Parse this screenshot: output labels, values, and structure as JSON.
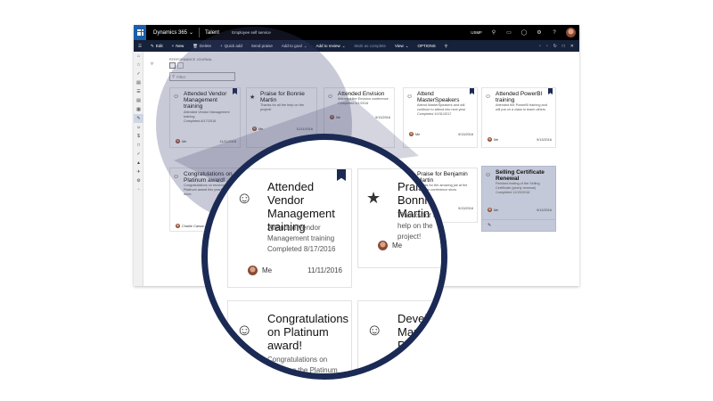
{
  "navbar": {
    "app_name": "Dynamics 365",
    "module": "Talent",
    "area": "Employee self service",
    "company": "USMF",
    "icons": [
      "search-icon",
      "chat-icon",
      "favorite-icon",
      "settings-icon",
      "help-icon"
    ]
  },
  "actionpane": {
    "edit": "Edit",
    "new": "New",
    "delete": "Delete",
    "quick_add": "Quick add",
    "send_praise": "Send praise",
    "add_to_goal": "Add to goal",
    "add_to_review": "Add to review",
    "mark_complete": "Mark as complete",
    "view": "View",
    "options": "OPTIONS"
  },
  "workspace": {
    "breadcrumb": "PERFORMANCE JOURNAL",
    "filter_placeholder": "Filter"
  },
  "cards": [
    {
      "icon": "person-icon",
      "title": "Attended Vendor Management training",
      "desc": "Attended Vendor Management training",
      "status": "Completed 8/17/2016",
      "person": "Me",
      "date": "11/11/2016",
      "bookmarked": true
    },
    {
      "icon": "star-icon",
      "title": "Praise for Bonnie Martin",
      "desc": "Thanks for all the help on the project!",
      "status": "",
      "person": "Me",
      "date": "11/11/2016",
      "bookmarked": false
    },
    {
      "icon": "person-icon",
      "title": "Attended Envision",
      "desc": "Attended the Envision conference",
      "status": "Completed 9/1/2016",
      "person": "Me",
      "date": "9/13/2016",
      "bookmarked": false
    },
    {
      "icon": "person-icon",
      "title": "Attend MasterSpeakers",
      "desc": "Attend MasterSpeakers and will continue to attend into next year",
      "status": "Completed 10/31/2017",
      "person": "Me",
      "date": "9/13/2016",
      "bookmarked": true
    },
    {
      "icon": "person-icon",
      "title": "Attended PowerBI training",
      "desc": "Attended the PowerBI training and will put on a class to teach others",
      "status": "",
      "person": "Me",
      "date": "9/13/2016",
      "bookmarked": true
    },
    {
      "icon": "group-icon",
      "title": "Congratulations on Platinum award!",
      "desc": "Congratulations on receiving the Platinum award this year! Well done.",
      "status": "",
      "person": "Charlie Carson",
      "date": "",
      "bookmarked": false
    },
    {
      "icon": "star-icon",
      "title": "Praise for Benjamin Martin",
      "desc": "Thanks for the amazing job at the Envision conference show",
      "status": "",
      "person": "Me",
      "date": "9/13/2016",
      "bookmarked": false
    },
    {
      "icon": "person-icon",
      "title": "Selling Certificate Renewal",
      "desc": "Finished testing of the Selling Certificate (yearly renewal)",
      "status": "Completed 12/20/2016",
      "person": "Me",
      "date": "9/13/2016",
      "bookmarked": false
    }
  ],
  "lens": {
    "card1": {
      "title": "Attended Vendor Management training",
      "desc": "Attended Vendor Management training",
      "status": "Completed 8/17/2016",
      "person": "Me",
      "date": "11/11/2016"
    },
    "card2": {
      "title": "Praise for Bonnie Martin",
      "desc": "Thanks for all the help on the project!",
      "person": "Me"
    },
    "card3": {
      "title": "Congratulations on Platinum award!",
      "desc": "Congratulations on receiving the Platinum award this year! Well done."
    },
    "card4": {
      "title": "Develop Marketing Program"
    }
  },
  "colors": {
    "navbar": "#000000",
    "actionpane": "#16223a",
    "lens_border": "#1b2a55",
    "selected_card": "#c4c9d9",
    "waffle": "#1b5fa8"
  }
}
